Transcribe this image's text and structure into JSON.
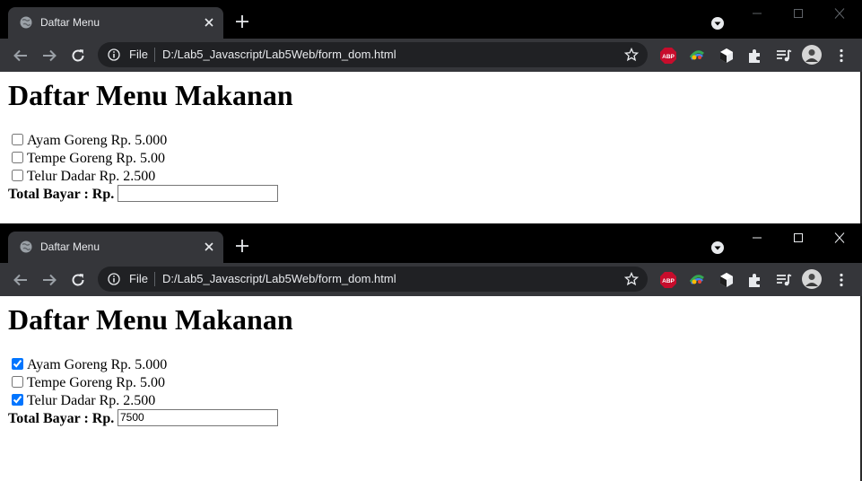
{
  "windows": [
    {
      "tab_title": "Daftar Menu",
      "address_scheme": "File",
      "address_url": "D:/Lab5_Javascript/Lab5Web/form_dom.html",
      "page_heading": "Daftar Menu Makanan",
      "menu_items": [
        {
          "label": "Ayam Goreng Rp. 5.000",
          "checked": false
        },
        {
          "label": "Tempe Goreng Rp. 5.00",
          "checked": false
        },
        {
          "label": "Telur Dadar Rp. 2.500",
          "checked": false
        }
      ],
      "total_label": "Total Bayar : Rp.",
      "total_value": ""
    },
    {
      "tab_title": "Daftar Menu",
      "address_scheme": "File",
      "address_url": "D:/Lab5_Javascript/Lab5Web/form_dom.html",
      "page_heading": "Daftar Menu Makanan",
      "menu_items": [
        {
          "label": "Ayam Goreng Rp. 5.000",
          "checked": true
        },
        {
          "label": "Tempe Goreng Rp. 5.00",
          "checked": false
        },
        {
          "label": "Telur Dadar Rp. 2.500",
          "checked": true
        }
      ],
      "total_label": "Total Bayar : Rp.",
      "total_value": "7500"
    }
  ],
  "extension_icons": [
    "adblock-plus-icon",
    "colorful-extension-icon",
    "cube-icon",
    "puzzle-icon",
    "playlist-icon",
    "profile-avatar"
  ],
  "colors": {
    "titlebar": "#000000",
    "toolbar": "#35363a",
    "omnibox": "#202124",
    "abp_red": "#c70d2c",
    "checkbox_blue": "#0075ff"
  }
}
